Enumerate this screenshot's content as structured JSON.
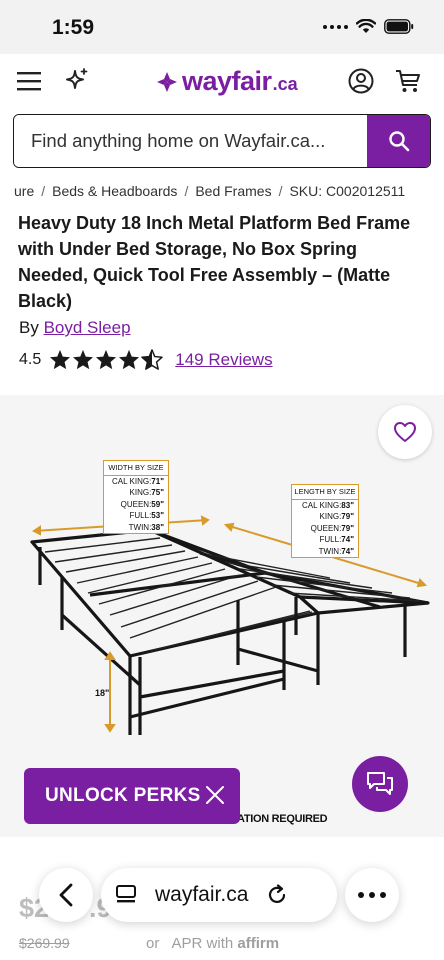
{
  "status_bar": {
    "time": "1:59"
  },
  "header": {
    "logo_word": "wayfair",
    "logo_suffix": ".ca",
    "icons": [
      "menu-icon",
      "sparkle-icon",
      "account-icon",
      "cart-icon"
    ]
  },
  "search": {
    "placeholder": "Find anything home on Wayfair.ca..."
  },
  "breadcrumb": {
    "items": [
      "ure",
      "Beds & Headboards",
      "Bed Frames"
    ],
    "sku": "SKU: C002012511"
  },
  "product": {
    "title": "Heavy Duty 18 Inch Metal Platform Bed Frame with Under Bed Storage, No Box Spring Needed, Quick Tool Free Assembly – (Matte Black)",
    "brand_prefix": "By",
    "brand": "Boyd Sleep",
    "rating": "4.5",
    "rating_value": 4.5,
    "reviews": "149 Reviews",
    "price": "$2",
    "price_tail": ".99",
    "old_price": "$269.99",
    "apr_prefix": "or",
    "apr_text": "APR with",
    "apr_brand": "affirm"
  },
  "image": {
    "width_box": {
      "title": "WIDTH BY SIZE",
      "rows": [
        {
          "k": "CAL KING:",
          "v": "71\""
        },
        {
          "k": "KING:",
          "v": "75\""
        },
        {
          "k": "QUEEN:",
          "v": "59\""
        },
        {
          "k": "FULL:",
          "v": "53\""
        },
        {
          "k": "TWIN:",
          "v": "38\""
        }
      ]
    },
    "length_box": {
      "title": "LENGTH BY SIZE",
      "rows": [
        {
          "k": "CAL KING:",
          "v": "83\""
        },
        {
          "k": "KING:",
          "v": "79\""
        },
        {
          "k": "QUEEN:",
          "v": "79\""
        },
        {
          "k": "FULL:",
          "v": "74\""
        },
        {
          "k": "TWIN:",
          "v": "74\""
        }
      ]
    },
    "height_label": "18\"",
    "caption": "ATION REQUIRED"
  },
  "promo": {
    "unlock_label": "UNLOCK PERKS"
  },
  "browser": {
    "url": "wayfair.ca"
  },
  "colors": {
    "brand": "#7b1fa2",
    "star": "#1a1a1a",
    "dimension_line": "#d89b2b"
  }
}
